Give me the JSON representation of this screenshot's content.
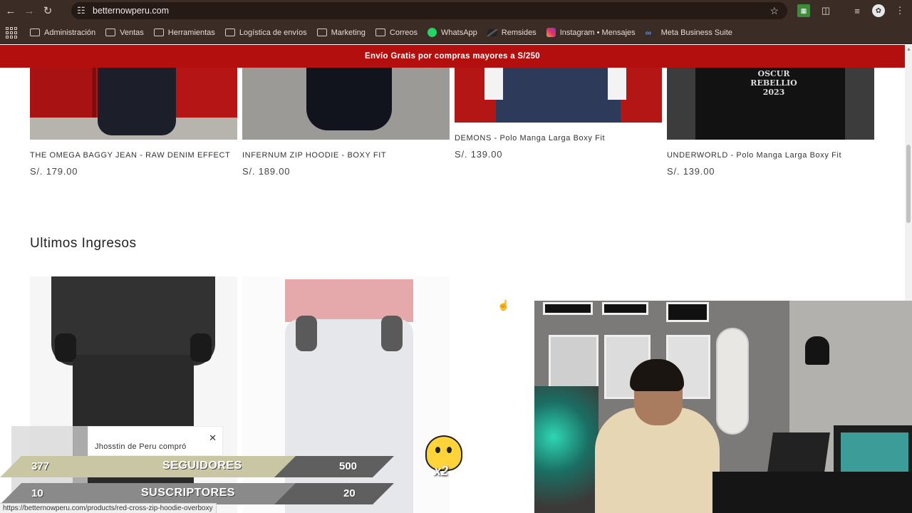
{
  "browser": {
    "url": "betternowperu.com",
    "status_url": "https://betternowperu.com/products/red-cross-zip-hoodie-overboxy"
  },
  "bookmarks": [
    {
      "label": "Administración",
      "icon": "folder-icon"
    },
    {
      "label": "Ventas",
      "icon": "folder-icon"
    },
    {
      "label": "Herramientas",
      "icon": "folder-icon"
    },
    {
      "label": "Logística de envíos",
      "icon": "folder-icon"
    },
    {
      "label": "Marketing",
      "icon": "folder-icon"
    },
    {
      "label": "Correos",
      "icon": "folder-icon"
    },
    {
      "label": "WhatsApp",
      "icon": "whatsapp-icon"
    },
    {
      "label": "Remsides",
      "icon": "remsides-icon"
    },
    {
      "label": "Instagram • Mensajes",
      "icon": "instagram-icon"
    },
    {
      "label": "Meta Business Suite",
      "icon": "meta-icon"
    }
  ],
  "promo_bar": {
    "text": "Envío Gratis por compras mayores a S/250"
  },
  "products": [
    {
      "title": "THE OMEGA BAGGY JEAN - RAW DENIM EFFECT",
      "price": "S/. 179.00"
    },
    {
      "title": "INFERNUM ZIP HOODIE - BOXY FIT",
      "price": "S/. 189.00"
    },
    {
      "title": "DEMONS - Polo Manga Larga Boxy Fit",
      "price": "S/. 139.00"
    },
    {
      "title": "UNDERWORLD - Polo Manga Larga Boxy Fit",
      "price": "S/. 139.00"
    }
  ],
  "print_text": "OSCUR\nREBELLIO\n2023",
  "section": {
    "title": "Ultimos Ingresos"
  },
  "toast": {
    "text": "Jhosstin de Peru compró"
  },
  "overlay": {
    "followers": {
      "current": "377",
      "label": "SEGUIDORES",
      "goal": "500"
    },
    "subscribers": {
      "current": "10",
      "label": "SUSCRIPTORES",
      "goal": "20"
    },
    "emote_multiplier": "x2"
  },
  "colors": {
    "promo_red": "#b30f0f",
    "chrome_brown": "#3b2c25",
    "followers_bar": "#c9c7a3",
    "subscribers_bar": "#8a8a8a"
  }
}
